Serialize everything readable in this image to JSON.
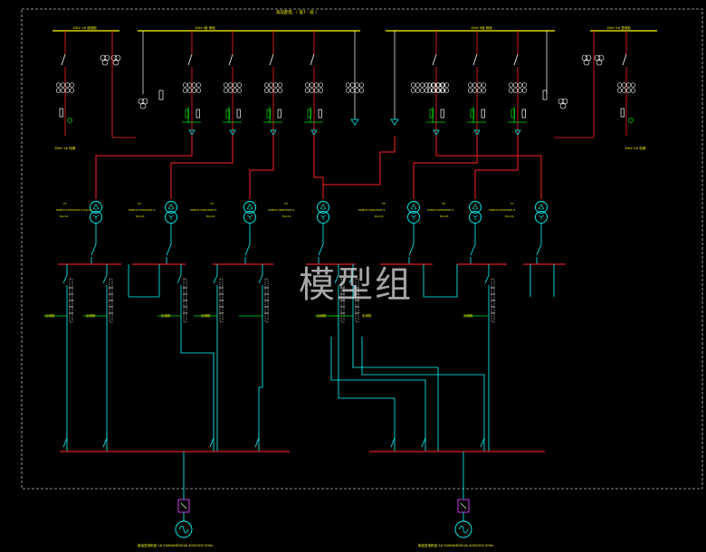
{
  "diagram": {
    "title": "高压配电  （ 低7 - 层 ）",
    "colors": {
      "background": "#000000",
      "busbar_hv": "#ffff00",
      "feeder_red": "#ff2020",
      "circuit_green": "#00e000",
      "lv_cyan": "#00ffff",
      "lv_bus_red": "#dd2020",
      "frame": "#bbbbbb",
      "generator_magenta": "#e040ff"
    },
    "hv_sections": [
      {
        "label": "10kV  1# 进线柜"
      },
      {
        "label": "10kV  I段 母线"
      },
      {
        "label": "10kV  II段 母线"
      },
      {
        "label": "10kV  2# 进线柜"
      }
    ],
    "incomer_notes": [
      {
        "text": "10kV 1# 电源"
      },
      {
        "text": "10kV 2# 电源"
      }
    ],
    "transformers": [
      {
        "id": "T1",
        "spec": "SCB10-1250/10/0.4 Dyn11",
        "sub": "Dyn11"
      },
      {
        "id": "T2",
        "spec": "SCB10-1250/10/0.4",
        "sub": "Dyn11"
      },
      {
        "id": "T3",
        "spec": "SCB10-1250/10/0.4",
        "sub": "Dyn11"
      },
      {
        "id": "T4",
        "spec": "SCB10-1600/10/0.4",
        "sub": "Dyn11"
      },
      {
        "id": "T5",
        "spec": "SCB10-1600/10/0.4",
        "sub": "Dyn11"
      },
      {
        "id": "T6",
        "spec": "SCB10-1250/10/0.4",
        "sub": "Dyn11"
      },
      {
        "id": "T7",
        "spec": "SCB10-1250/10/0.4",
        "sub": "Dyn11"
      }
    ],
    "outgoing_labels": [
      {
        "text": "出线柜"
      },
      {
        "text": "出线柜"
      },
      {
        "text": "出线柜"
      },
      {
        "text": "出线柜"
      },
      {
        "text": "出线柜"
      },
      {
        "text": "出线柜"
      },
      {
        "text": "出线柜"
      }
    ],
    "generators": [
      {
        "label": "柴油发电机组  1# 500kW/625kVA 400/230V 50Hz"
      },
      {
        "label": "柴油发电机组  2# 500kW/625kVA 400/230V 50Hz"
      }
    ],
    "watermark": "模型组"
  }
}
